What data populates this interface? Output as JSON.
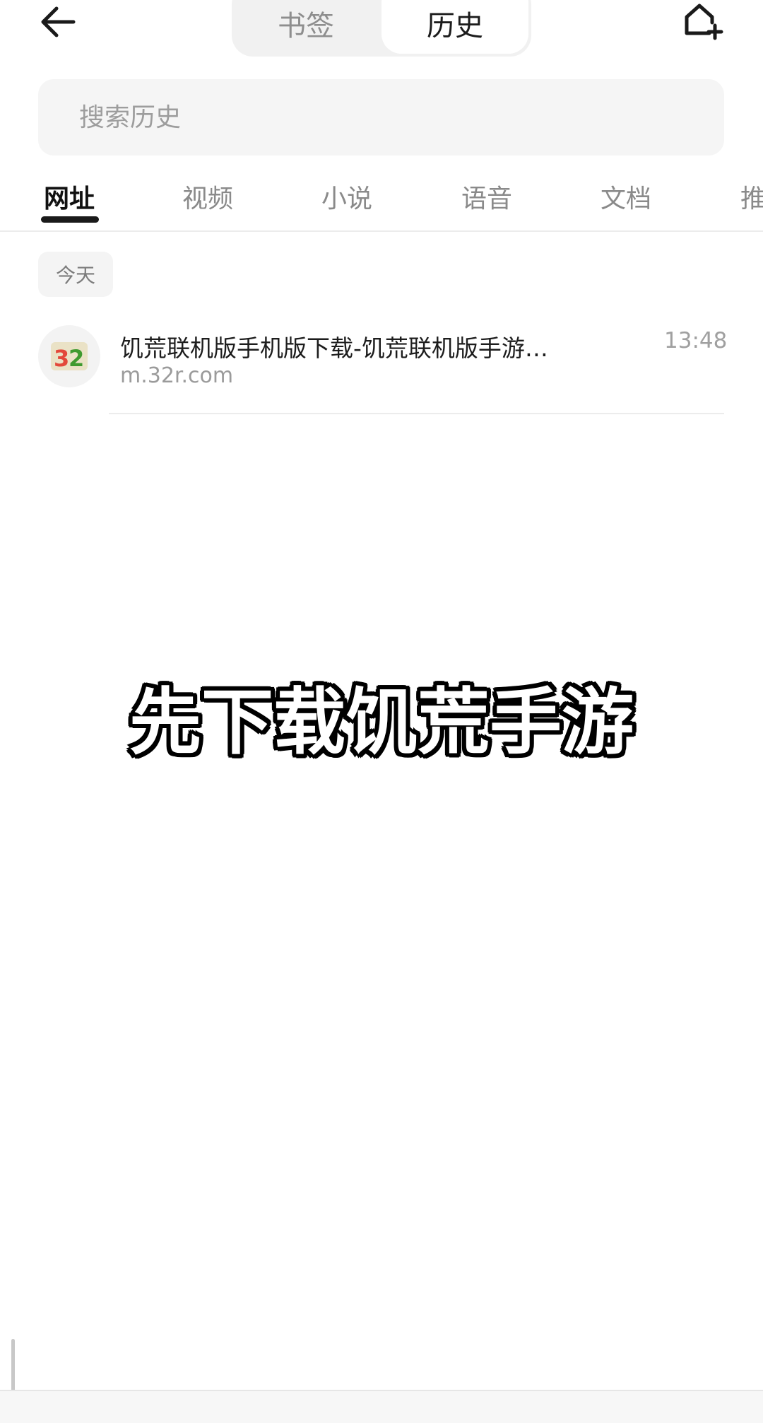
{
  "header": {
    "back_icon": "arrow-left-icon",
    "segments": [
      {
        "label": "书签",
        "selected": false
      },
      {
        "label": "历史",
        "selected": true
      }
    ],
    "add_home_icon": "home-plus-icon"
  },
  "search": {
    "placeholder": "搜索历史",
    "value": ""
  },
  "category_tabs": [
    {
      "label": "网址",
      "active": true
    },
    {
      "label": "视频",
      "active": false
    },
    {
      "label": "小说",
      "active": false
    },
    {
      "label": "语音",
      "active": false
    },
    {
      "label": "文档",
      "active": false
    },
    {
      "label": "推",
      "active": false
    }
  ],
  "sections": [
    {
      "label": "今天",
      "items": [
        {
          "favicon_text": "32",
          "title": "饥荒联机版手机版下载-饥荒联机版手游…",
          "url": "m.32r.com",
          "time": "13:48"
        }
      ]
    }
  ],
  "overlay_caption": "先下载饥荒手游",
  "colors": {
    "text_primary": "#1d1d1d",
    "text_secondary": "#9b9b9b",
    "search_bg": "#f5f5f5",
    "segment_bg": "#f1f1f1",
    "active_underline": "#1a1a1a"
  }
}
